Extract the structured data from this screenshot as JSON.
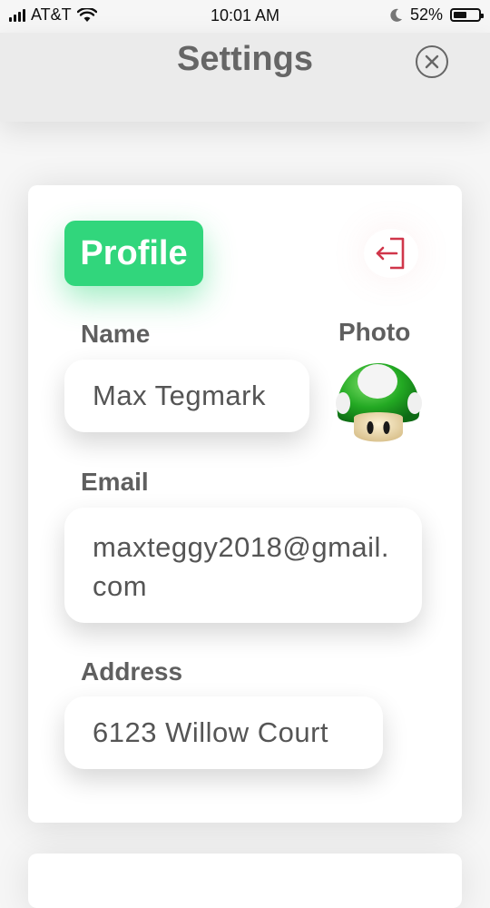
{
  "status_bar": {
    "carrier": "AT&T",
    "time": "10:01 AM",
    "battery": "52%",
    "battery_level": 0.52,
    "icons": [
      "signal-icon",
      "wifi-icon",
      "moon-icon",
      "battery-icon"
    ]
  },
  "header": {
    "title": "Settings",
    "close_icon": "close-circle-icon"
  },
  "profile": {
    "badge_label": "Profile",
    "logout_icon": "logout-icon",
    "name_label": "Name",
    "name_value": "Max Tegmark",
    "photo_label": "Photo",
    "photo_icon": "mushroom-avatar-icon",
    "email_label": "Email",
    "email_value": "maxteggy2018@gmail.com",
    "address_label": "Address",
    "address_value": "6123 Willow Court"
  },
  "colors": {
    "accent": "#31d67c",
    "logout": "#d0364a",
    "background": "#f6f6f6"
  }
}
